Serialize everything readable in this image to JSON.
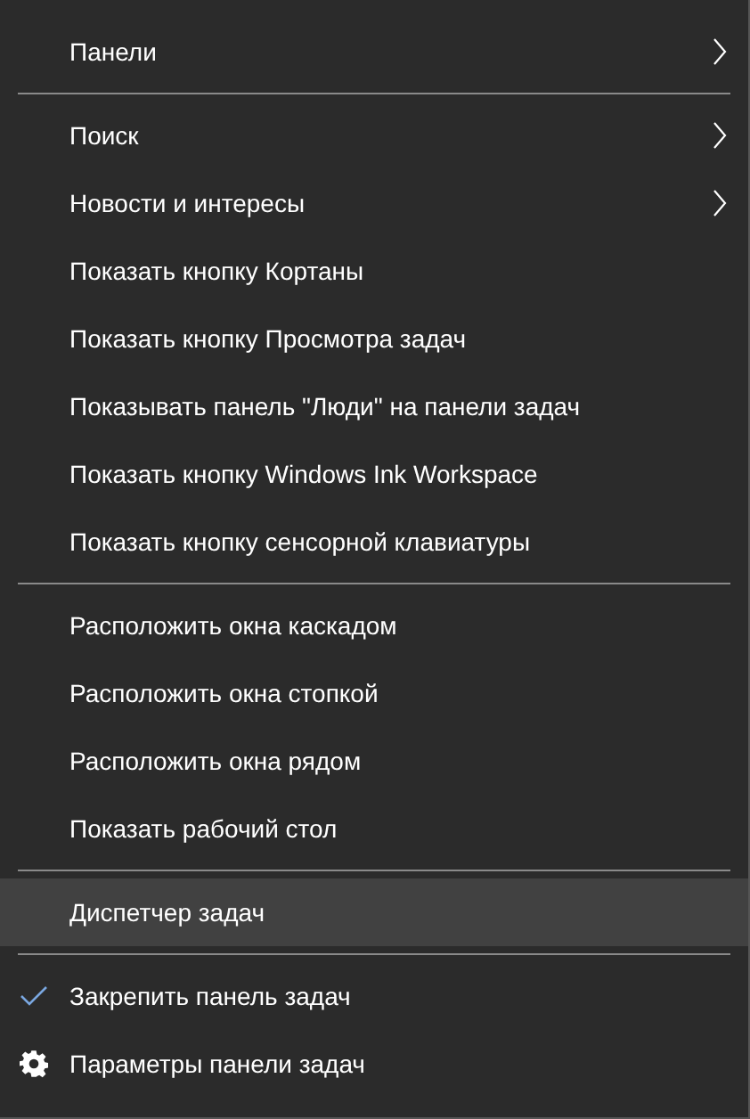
{
  "groups": [
    {
      "items": [
        {
          "kind": "submenu",
          "label": "Панели",
          "selected": false
        }
      ]
    },
    {
      "items": [
        {
          "kind": "submenu",
          "label": "Поиск",
          "selected": false
        },
        {
          "kind": "submenu",
          "label": "Новости и интересы",
          "selected": false
        },
        {
          "kind": "plain",
          "label": "Показать кнопку Кортаны",
          "selected": false
        },
        {
          "kind": "plain",
          "label": "Показать кнопку Просмотра задач",
          "selected": false
        },
        {
          "kind": "plain",
          "label": "Показывать панель \"Люди\" на панели задач",
          "selected": false
        },
        {
          "kind": "plain",
          "label": "Показать кнопку Windows Ink Workspace",
          "selected": false
        },
        {
          "kind": "plain",
          "label": "Показать кнопку сенсорной клавиатуры",
          "selected": false
        }
      ]
    },
    {
      "items": [
        {
          "kind": "plain",
          "label": "Расположить окна каскадом",
          "selected": false
        },
        {
          "kind": "plain",
          "label": "Расположить окна стопкой",
          "selected": false
        },
        {
          "kind": "plain",
          "label": "Расположить окна рядом",
          "selected": false
        },
        {
          "kind": "plain",
          "label": "Показать рабочий стол",
          "selected": false
        }
      ]
    },
    {
      "items": [
        {
          "kind": "plain",
          "label": "Диспетчер задач",
          "selected": true
        }
      ]
    },
    {
      "items": [
        {
          "kind": "check",
          "label": "Закрепить панель задач",
          "checked": true,
          "selected": false
        },
        {
          "kind": "settings",
          "label": "Параметры панели задач",
          "selected": false
        }
      ]
    }
  ]
}
